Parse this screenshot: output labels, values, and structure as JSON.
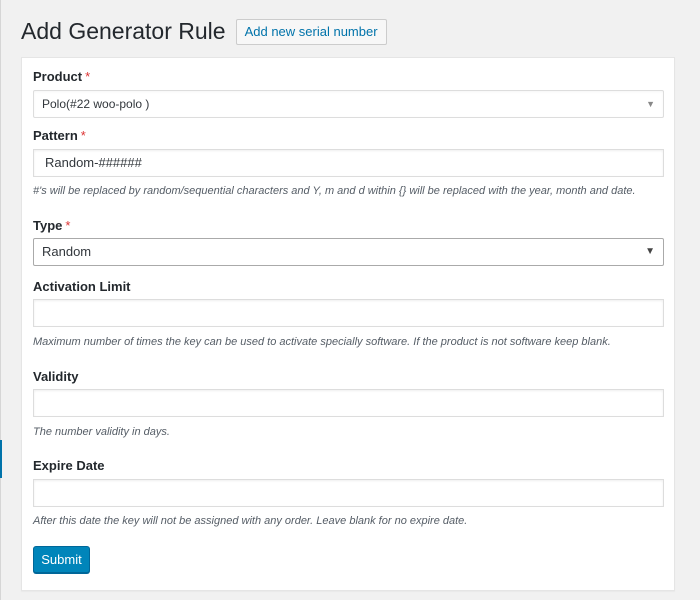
{
  "header": {
    "title": "Add Generator Rule",
    "add_new_label": "Add new serial number"
  },
  "form": {
    "required_marker": "*",
    "product": {
      "label": "Product",
      "selected": "Polo(#22 woo-polo )",
      "caret_icon": "caret-down-icon"
    },
    "pattern": {
      "label": "Pattern",
      "value": "Random-######",
      "description": "#'s will be replaced by random/sequential characters and Y, m and d within {} will be replaced with the year, month and date."
    },
    "type": {
      "label": "Type",
      "selected": "Random",
      "caret_icon": "caret-down-icon"
    },
    "activation_limit": {
      "label": "Activation Limit",
      "value": "",
      "description": "Maximum number of times the key can be used to activate specially software. If the product is not software keep blank."
    },
    "validity": {
      "label": "Validity",
      "value": "",
      "description": "The number validity in days."
    },
    "expire_date": {
      "label": "Expire Date",
      "value": "",
      "description": "After this date the key will not be assigned with any order. Leave blank for no expire date."
    },
    "submit_label": "Submit"
  },
  "colors": {
    "accent": "#0085ba",
    "link": "#0073aa",
    "required": "#dc3232",
    "background": "#f1f1f1"
  }
}
